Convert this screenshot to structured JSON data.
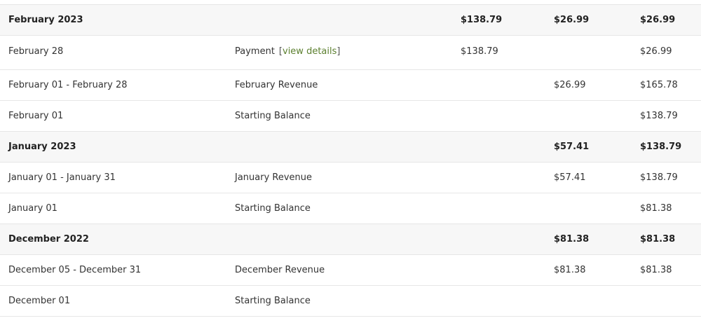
{
  "ledger": {
    "groups": [
      {
        "label": "February 2023",
        "debit": "$138.79",
        "credit": "$26.99",
        "balance": "$26.99",
        "entries": [
          {
            "date": "February 28",
            "description": "Payment",
            "link_open": "[",
            "link_label": "view details",
            "link_close": "]",
            "debit": "$138.79",
            "credit": "",
            "balance": "$26.99"
          },
          {
            "date": "February 01 - February 28",
            "description": "February Revenue",
            "debit": "",
            "credit": "$26.99",
            "balance": "$165.78"
          },
          {
            "date": "February 01",
            "description": "Starting Balance",
            "debit": "",
            "credit": "",
            "balance": "$138.79"
          }
        ]
      },
      {
        "label": "January 2023",
        "debit": "",
        "credit": "$57.41",
        "balance": "$138.79",
        "entries": [
          {
            "date": "January 01 - January 31",
            "description": "January Revenue",
            "debit": "",
            "credit": "$57.41",
            "balance": "$138.79"
          },
          {
            "date": "January 01",
            "description": "Starting Balance",
            "debit": "",
            "credit": "",
            "balance": "$81.38"
          }
        ]
      },
      {
        "label": "December 2022",
        "debit": "",
        "credit": "$81.38",
        "balance": "$81.38",
        "entries": [
          {
            "date": "December 05 - December 31",
            "description": "December Revenue",
            "debit": "",
            "credit": "$81.38",
            "balance": "$81.38"
          },
          {
            "date": "December 01",
            "description": "Starting Balance",
            "debit": "",
            "credit": "",
            "balance": ""
          }
        ]
      }
    ]
  }
}
